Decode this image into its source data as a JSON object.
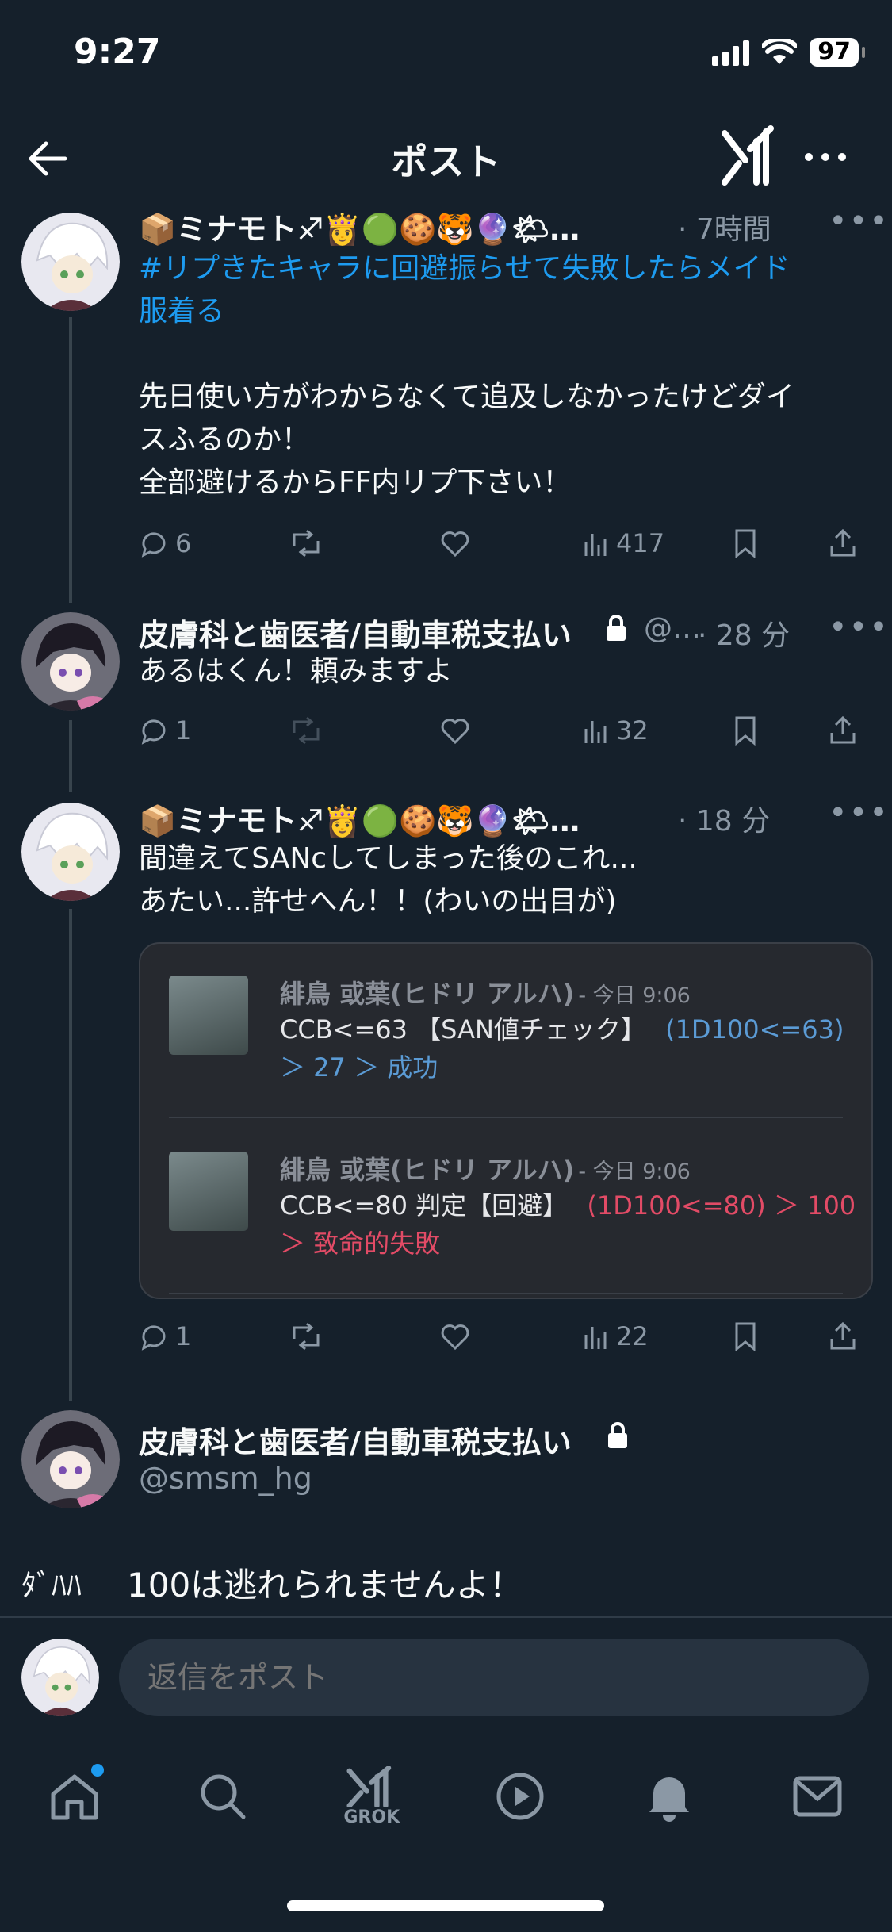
{
  "status": {
    "time": "9:27",
    "battery": "97"
  },
  "header": {
    "title": "ポスト"
  },
  "posts": [
    {
      "name": "📦ミナモト♐👸🟢🍪🐯🔮🌤…",
      "time": "· 7時間",
      "hashtag_line1": "#リプきたキャラに回避振らせて失敗したらメイド",
      "hashtag_line2": "服着る",
      "line1": "先日使い方がわからなくて追及しなかったけどダイ",
      "line2": "スふるのか！",
      "line3": "全部避けるからFF内リプ下さい！",
      "replies": "6",
      "views": "417"
    },
    {
      "name": "皮膚科と歯医者/自動車税支払い",
      "handle": "@…",
      "time": "· 28 分",
      "line1": "あるはくん！頼みますよ",
      "replies": "1",
      "views": "32"
    },
    {
      "name": "📦ミナモト♐👸🟢🍪🐯🔮🌤…",
      "time": "· 18 分",
      "line1": "間違えてSANcしてしまった後のこれ...",
      "line2": "あたい...許せへん！！(わいの出目が)",
      "replies": "1",
      "views": "22"
    }
  ],
  "card": {
    "messages": [
      {
        "name": "緋鳥 或葉(ヒドリ アルハ)",
        "time": "- 今日 9:06",
        "text_a": "CCB<=63 【SAN値チェック】",
        "text_b": "(1D100<=63)",
        "text_c": "＞ 27 ＞ 成功"
      },
      {
        "name": "緋鳥 或葉(ヒドリ アルハ)",
        "time": "- 今日 9:06",
        "text_a": "CCB<=80 判定【回避】",
        "text_b": "(1D100<=80) ＞ 100",
        "text_c": "＞ 致命的失敗"
      }
    ]
  },
  "reply_target": {
    "name": "皮膚科と歯医者/自動車税支払い",
    "handle": "@smsm_hg",
    "prefix": "ﾀﾞﾊﾊ",
    "text": "100は逃れられませんよ！"
  },
  "composer": {
    "placeholder": "返信をポスト"
  },
  "tabbar": {
    "grok_label": "GROK"
  },
  "colors": {
    "background": "#15202b",
    "accent": "#1d9bf0",
    "muted": "#8b98a5"
  }
}
